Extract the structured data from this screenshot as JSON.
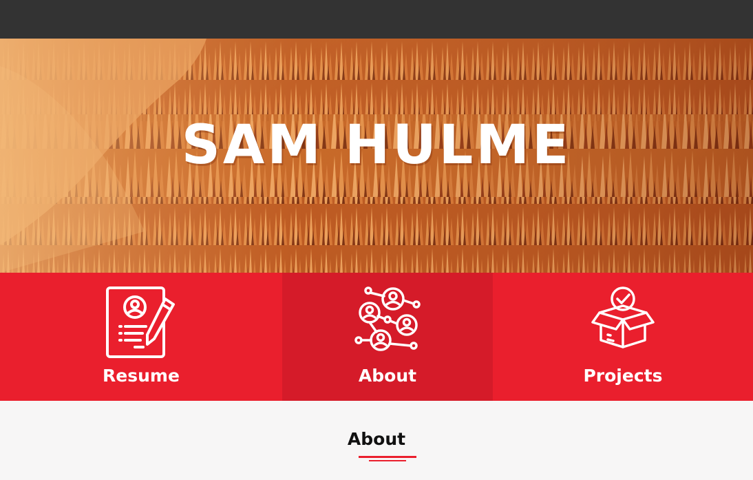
{
  "hero": {
    "title": "SAM HULME"
  },
  "nav": {
    "items": [
      {
        "label": "Resume",
        "icon": "resume-icon"
      },
      {
        "label": "About",
        "icon": "network-people-icon"
      },
      {
        "label": "Projects",
        "icon": "open-box-icon"
      }
    ],
    "active": "About"
  },
  "section": {
    "title": "About"
  },
  "colors": {
    "topbar": "#333333",
    "accent": "#ea1f2d",
    "accent_active": "#d51b29",
    "background": "#f7f6f6"
  }
}
